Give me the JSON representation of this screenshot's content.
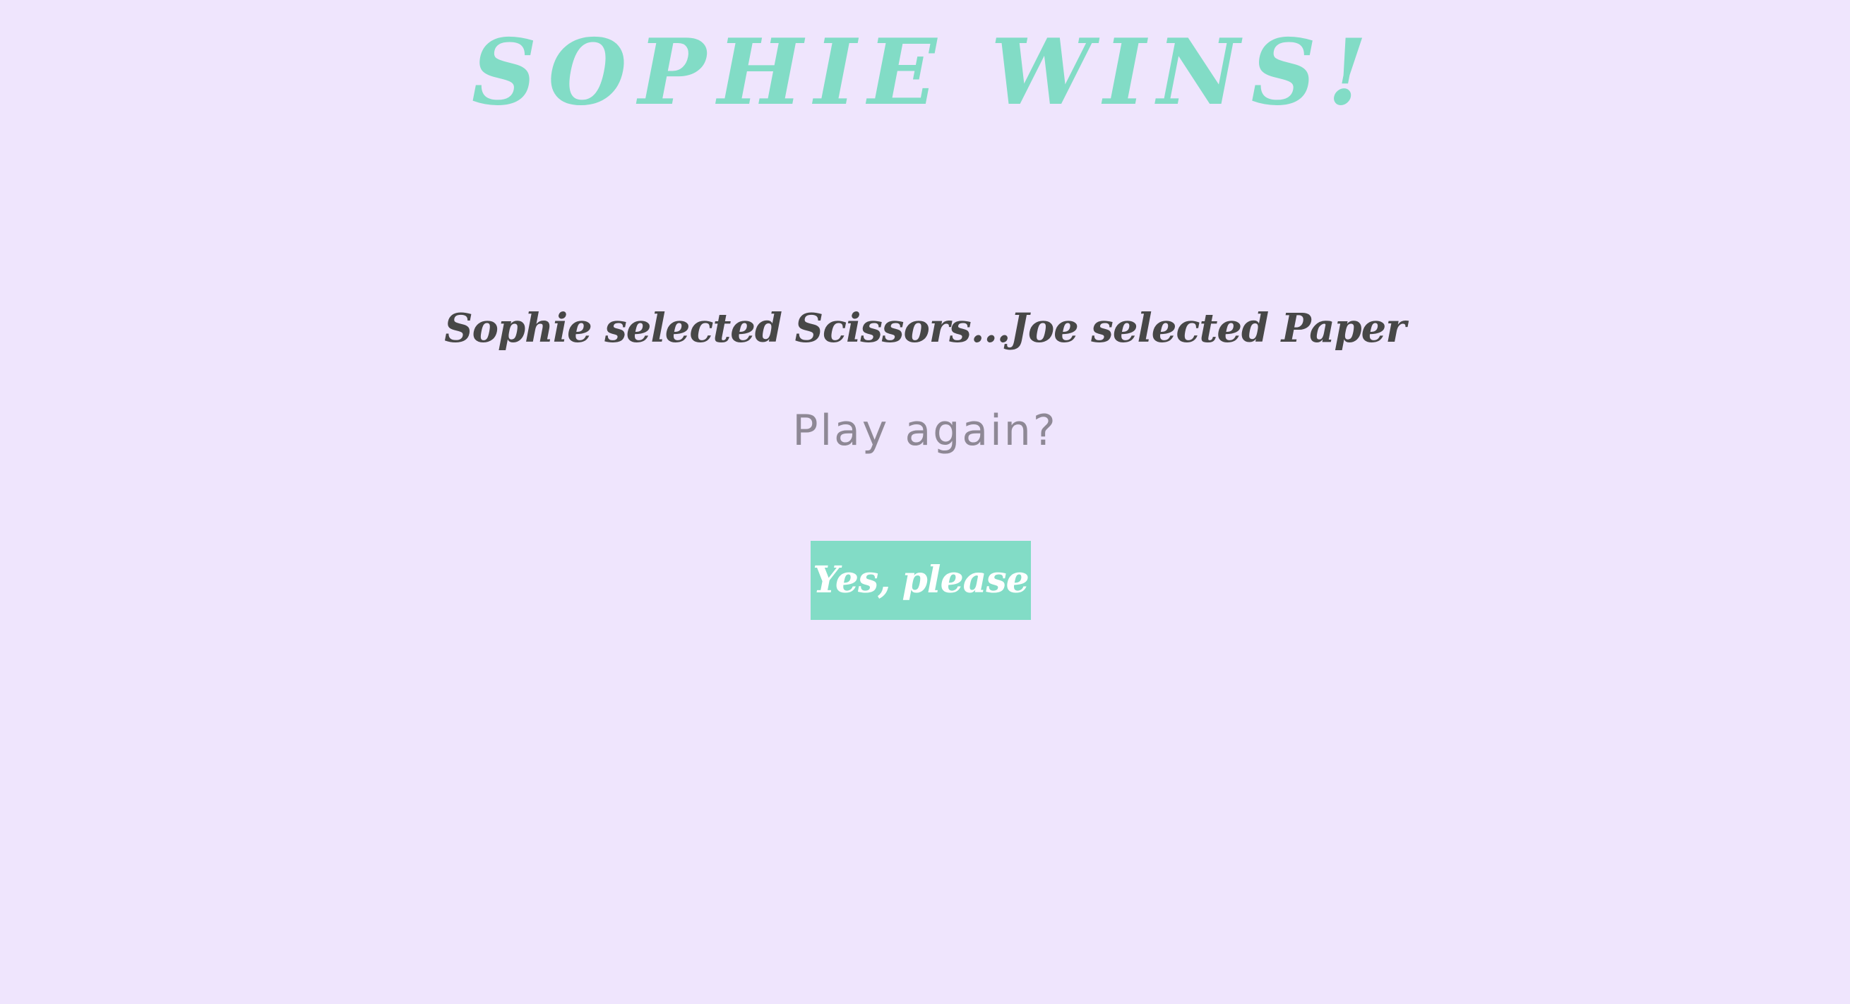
{
  "game": {
    "winner_title": "Sophie wins!",
    "result_text": "Sophie selected Scissors...Joe selected Paper",
    "prompt_text": "Play again?",
    "play_again_label": "Yes, please"
  },
  "colors": {
    "background": "#efe5fd",
    "accent": "#82dcc6",
    "result_text": "#474747",
    "prompt_text": "#8e8895",
    "button_text": "#ffffff"
  }
}
